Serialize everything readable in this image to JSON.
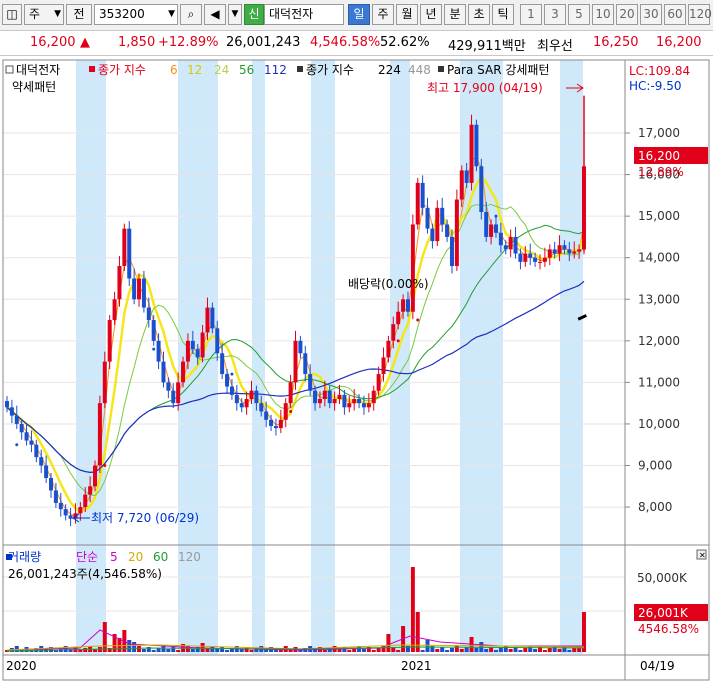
{
  "toolbar": {
    "market": "주",
    "mode": "전",
    "code": "353200",
    "badge": "신",
    "name": "대덕전자",
    "periods": [
      "일",
      "주",
      "월",
      "년",
      "분",
      "초",
      "틱"
    ],
    "active_period": "일",
    "minutes": [
      "1",
      "3",
      "5",
      "10",
      "20",
      "30",
      "60",
      "120"
    ]
  },
  "quote": {
    "price": "16,200",
    "change": "1,850",
    "change_pct": "+12.89%",
    "volume": "26,001,243",
    "volume_ratio": "4,546.58%",
    "turnover": "52.62%",
    "amount": "429,911백만",
    "best_label": "최우선",
    "ask": "16,250",
    "bid": "16,200"
  },
  "legend": {
    "name": "대덕전자",
    "ma_label": "종가 지수",
    "ma_periods": [
      "6",
      "12",
      "24",
      "56",
      "112"
    ],
    "ma2_label": "종가 지수",
    "ma2_periods": [
      "224",
      "448"
    ],
    "sar_label": "Para SAR 강세패턴",
    "weak_label": "약세패턴",
    "lc": "LC:109.84",
    "hc": "HC:-9.50"
  },
  "annotations": {
    "high": "최고 17,900 (04/19)",
    "low": "최저 7,720 (06/29)",
    "dividend": "배당락(0.00%)"
  },
  "price_badge": {
    "price": "16,200",
    "pct": "12.89%"
  },
  "volume_panel": {
    "title": "거래량",
    "ma_label": "단순",
    "ma_periods": [
      "5",
      "20",
      "60",
      "120"
    ],
    "value_label": "26,001,243주(4,546.58%)",
    "axis_top": "50,000K",
    "badge": "26,001K",
    "badge_pct": "4546.58%"
  },
  "x_labels": {
    "start": "2020",
    "mid": "2021",
    "end": "04/19"
  },
  "colors": {
    "up": "#e0001a",
    "down": "#1a4fd0",
    "shade": "#cfe9fb",
    "ma6": "#ff8c1a",
    "ma12": "#f5e61a",
    "ma24": "#7ac943",
    "ma56": "#1f9e2f",
    "ma112": "#1f2fbf"
  },
  "chart_data": {
    "type": "candlestick",
    "y_ticks": [
      "17,000",
      "16,000",
      "15,000",
      "14,000",
      "13,000",
      "12,000",
      "11,000",
      "10,000",
      "9,000",
      "8,000"
    ],
    "ylim": [
      7400,
      18300
    ],
    "x_labels": [
      "2020",
      "2021",
      "04/19"
    ],
    "series": [
      {
        "name": "close",
        "values": [
          10400,
          10200,
          10000,
          9800,
          9600,
          9500,
          9200,
          9000,
          8700,
          8400,
          8100,
          7950,
          7800,
          7720,
          7850,
          8000,
          8300,
          8500,
          9000,
          10500,
          11500,
          12500,
          13000,
          13800,
          14700,
          13500,
          13000,
          13500,
          12800,
          12500,
          12000,
          11500,
          11000,
          10800,
          10500,
          11000,
          11500,
          12000,
          11800,
          11600,
          12200,
          12800,
          12300,
          11700,
          11200,
          10900,
          10700,
          10500,
          10400,
          10600,
          10800,
          10500,
          10300,
          10100,
          9950,
          9900,
          10100,
          10500,
          11000,
          12000,
          11700,
          11200,
          10800,
          10500,
          10600,
          10800,
          10500,
          10600,
          10700,
          10400,
          10500,
          10600,
          10500,
          10400,
          10500,
          10800,
          11200,
          11600,
          12000,
          12400,
          12700,
          13000,
          12700,
          14800,
          15800,
          15200,
          14700,
          14400,
          15200,
          14800,
          14500,
          13800,
          15400,
          16100,
          15800,
          17200,
          16200,
          15100,
          14500,
          14800,
          14600,
          14300,
          14200,
          14500,
          14100,
          13900,
          14100,
          14000,
          13900,
          13900,
          14000,
          14200,
          14100,
          14300,
          14200,
          14100,
          14150,
          14200,
          16200
        ]
      }
    ]
  }
}
